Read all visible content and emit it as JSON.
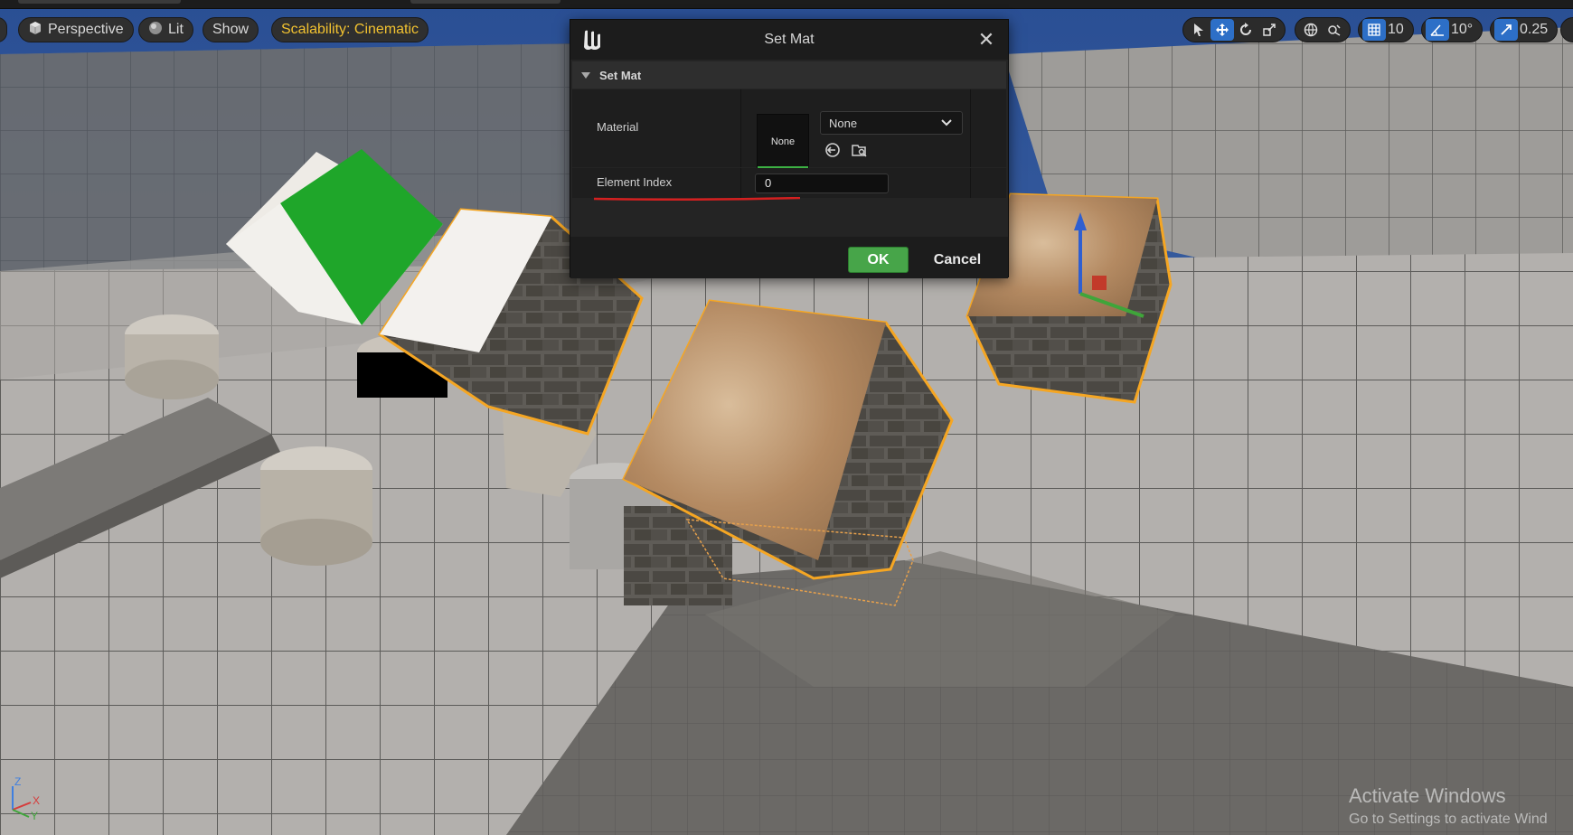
{
  "viewport_toolbar": {
    "perspective_label": "Perspective",
    "lit_label": "Lit",
    "show_label": "Show",
    "scalability_label": "Scalability: Cinematic",
    "grid_snap_value": "10",
    "rotation_snap_value": "10°",
    "scale_snap_value": "0.25",
    "icons": [
      "select-icon",
      "translate-icon",
      "rotate-icon",
      "scale-icon",
      "world-local-icon",
      "surface-snap-icon",
      "grid-snap-icon",
      "rotation-snap-icon",
      "scale-snap-icon"
    ]
  },
  "dialog": {
    "title": "Set Mat",
    "section_title": "Set Mat",
    "material_label": "Material",
    "material_thumbnail_text": "None",
    "material_combo_value": "None",
    "element_index_label": "Element Index",
    "element_index_value": "0",
    "ok_label": "OK",
    "cancel_label": "Cancel"
  },
  "colors": {
    "accent_blue": "#2d6fc7",
    "ok_green": "#47a549",
    "selection_orange": "#f5a623",
    "annotation_red": "#d42020",
    "scalability_yellow": "#f2c230"
  },
  "watermark": {
    "line1": "Activate Windows",
    "line2": "Go to Settings to activate Wind"
  },
  "axis_labels": {
    "z": "Z",
    "x": "X",
    "y": "Y"
  }
}
